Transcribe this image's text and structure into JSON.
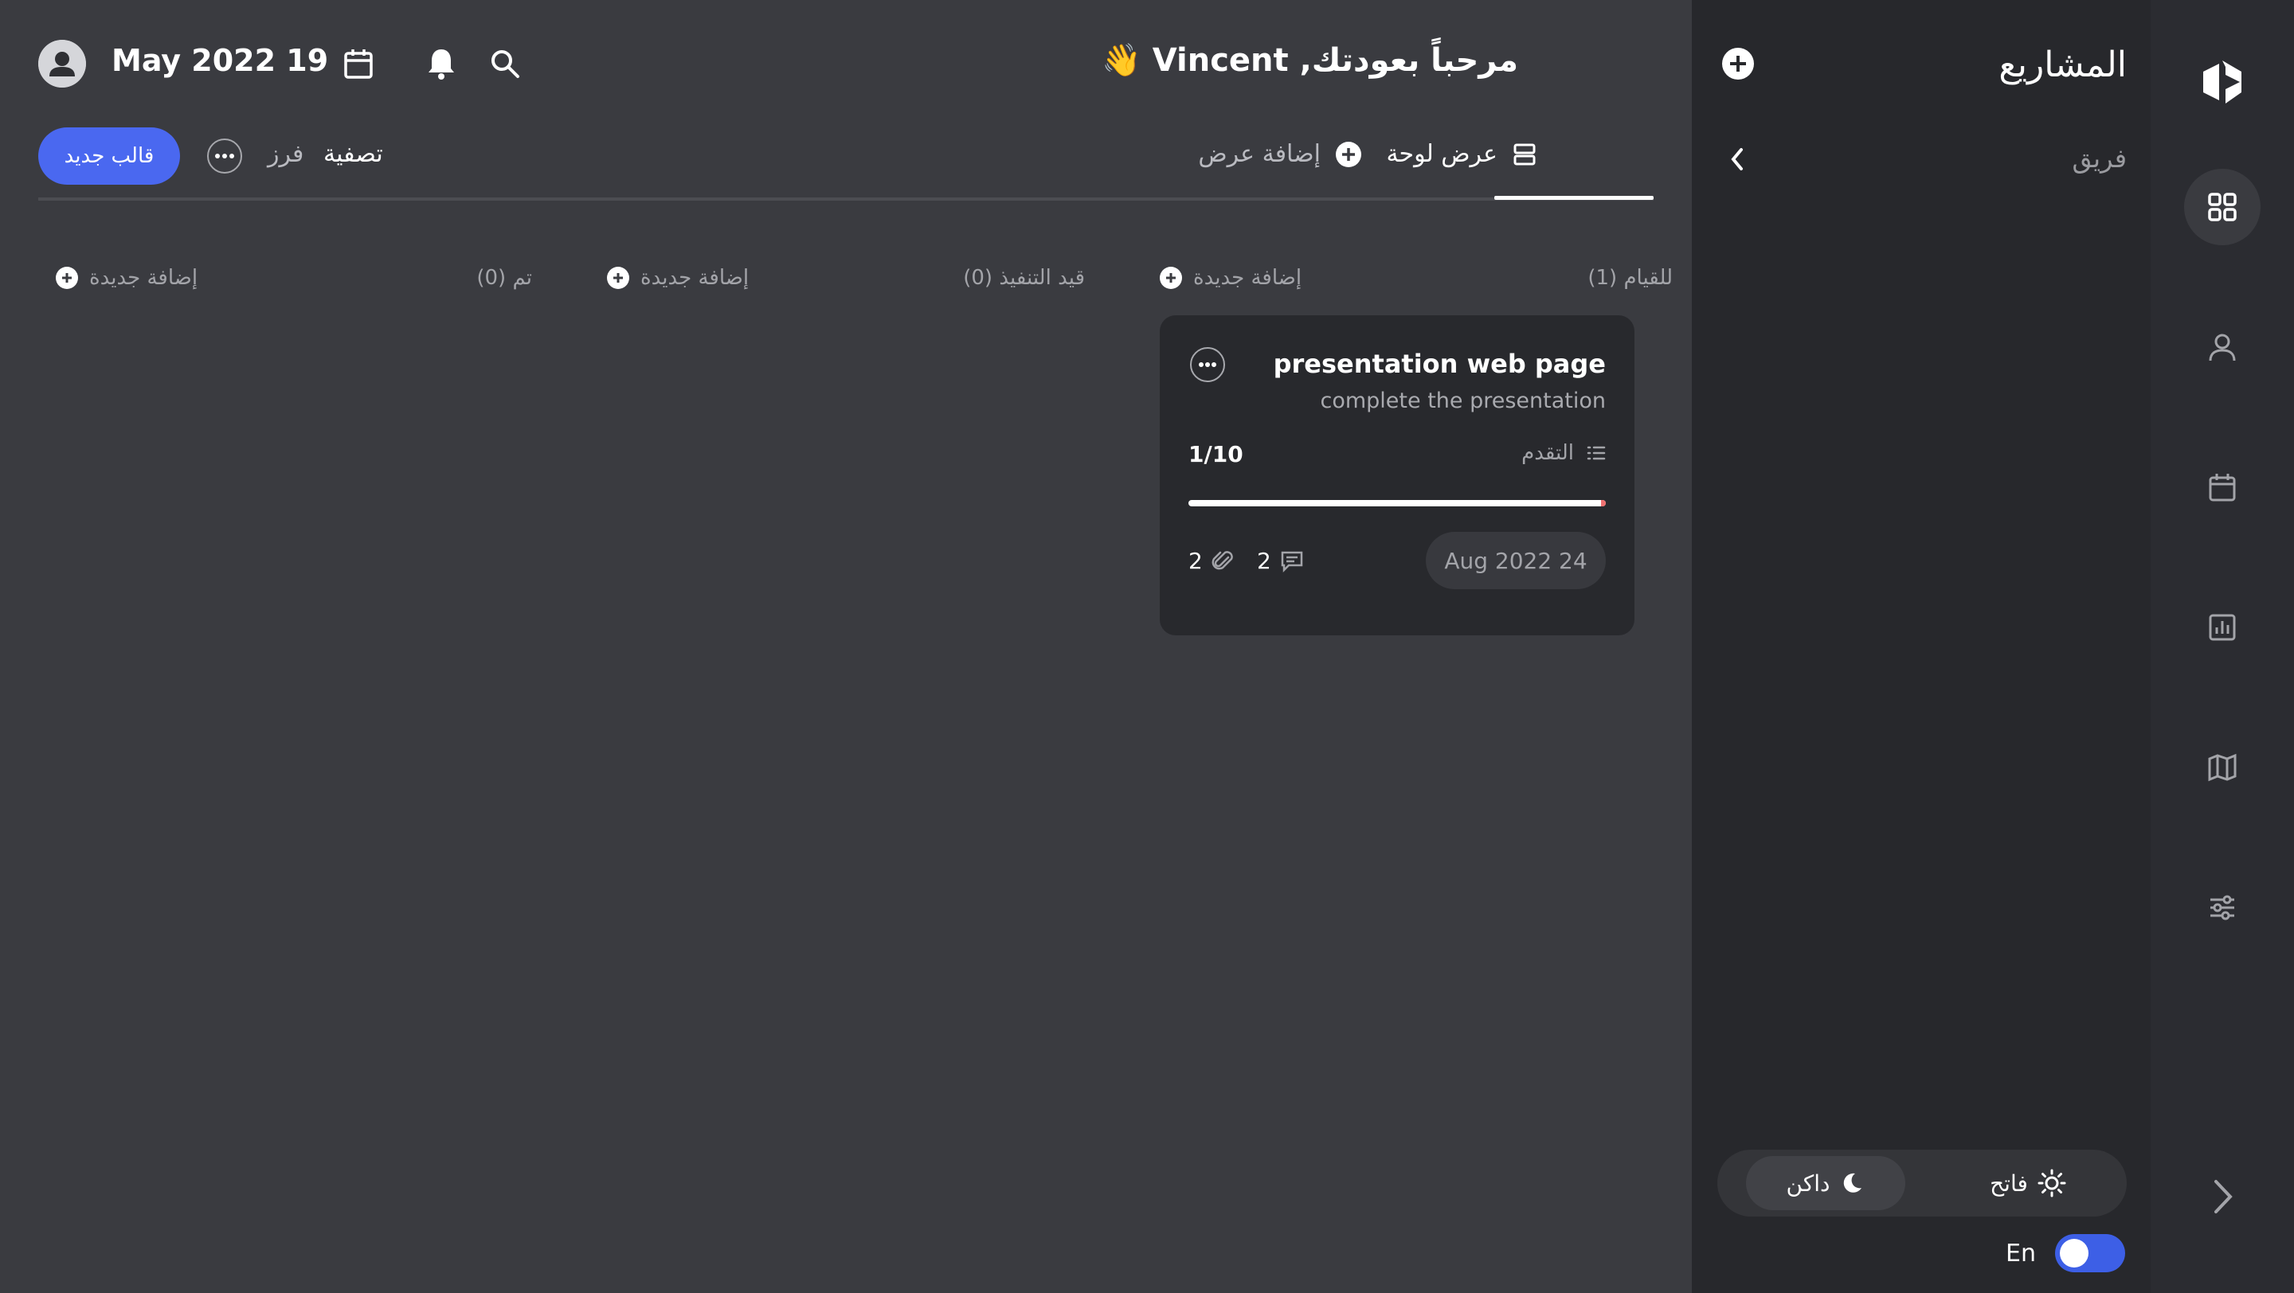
{
  "header": {
    "date": "May 2022 19",
    "welcome": "مرحباً بعودتك, Vincent 👋",
    "icons": [
      "calendar-icon",
      "bell-icon",
      "search-icon",
      "user-avatar-icon"
    ]
  },
  "toolbar": {
    "new_template_label": "قالب جديد",
    "sort_label": "فرز",
    "filter_label": "تصفية",
    "board_view_label": "عرض لوحة",
    "add_view_label": "إضافة عرض"
  },
  "columns": [
    {
      "title": "للقيام (1)",
      "add_label": "إضافة جديدة"
    },
    {
      "title": "قيد التنفيذ (0)",
      "add_label": "إضافة جديدة"
    },
    {
      "title": "تم (0)",
      "add_label": "إضافة جديدة"
    }
  ],
  "card": {
    "title": "presentation web page",
    "description": "complete the presentation",
    "progress_label": "التقدم",
    "progress_count": "1/10",
    "progress_fraction": 0.1,
    "due_date": "Aug 2022 24",
    "comments": "2",
    "attachments": "2"
  },
  "sidebar": {
    "title": "المشاريع",
    "team_label": "فريق",
    "theme": {
      "dark_label": "داكن",
      "light_label": "فاتح",
      "selected": "dark"
    },
    "language_label": "En"
  },
  "rail": {
    "items": [
      "grid-icon",
      "user-icon",
      "calendar-icon",
      "chart-icon",
      "map-icon",
      "sliders-icon"
    ],
    "active": "grid-icon"
  },
  "colors": {
    "accent": "#4a68f0",
    "background": "#3a3b40",
    "sidebar": "#27282c",
    "rail": "#2b2c31",
    "card": "#28292d",
    "progress_marker": "#f07070"
  }
}
